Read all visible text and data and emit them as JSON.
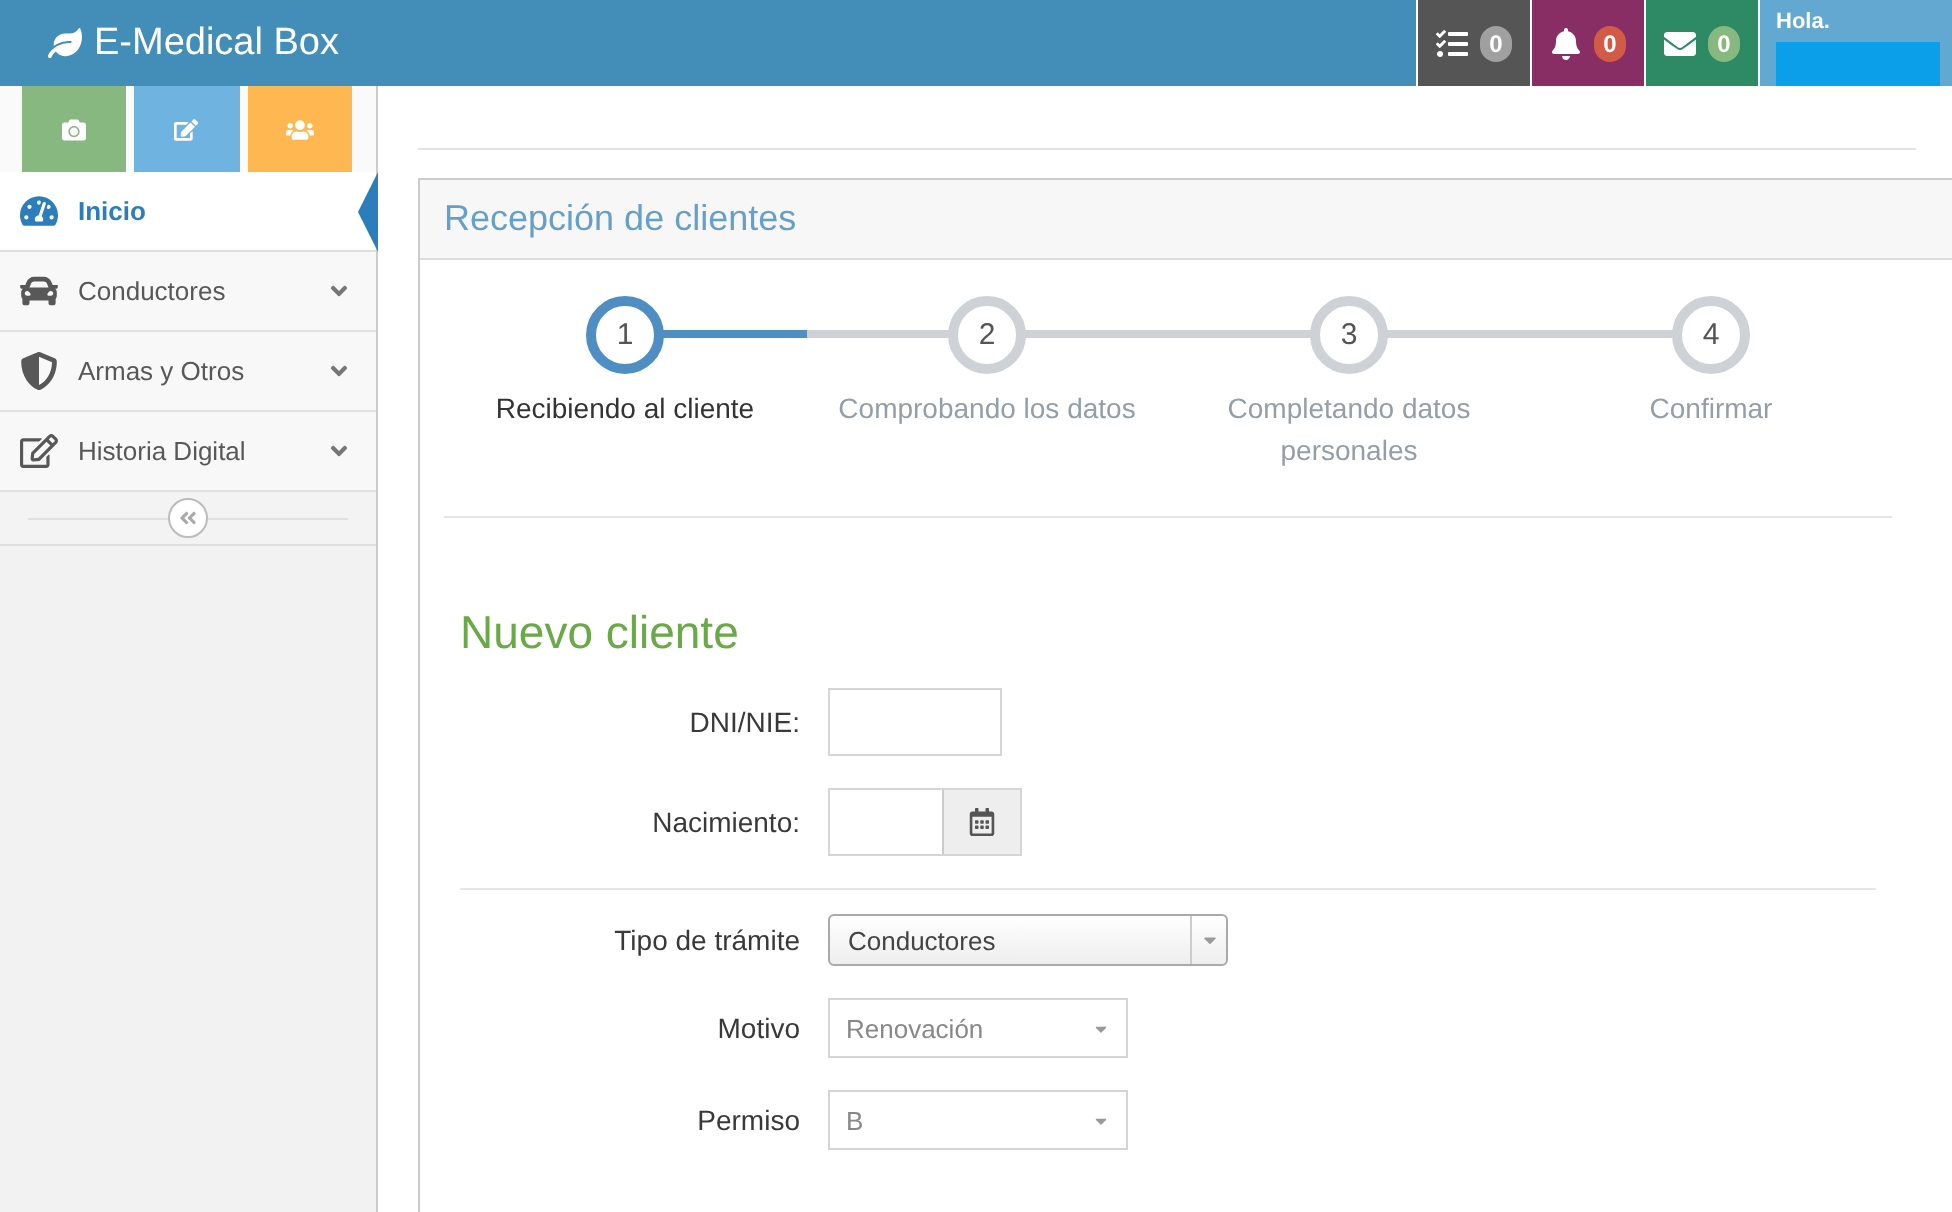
{
  "brand": {
    "title": "E-Medical Box"
  },
  "notifications": [
    {
      "count": "0",
      "color": "#555555"
    },
    {
      "count": "0",
      "color": "#892e65"
    },
    {
      "count": "0",
      "color": "#2e8965"
    }
  ],
  "user": {
    "greeting": "Hola."
  },
  "sidebar": {
    "items": [
      {
        "label": "Inicio",
        "selected": true,
        "expandable": false
      },
      {
        "label": "Conductores",
        "selected": false,
        "expandable": true
      },
      {
        "label": "Armas y Otros",
        "selected": false,
        "expandable": true
      },
      {
        "label": "Historia Digital",
        "selected": false,
        "expandable": true
      }
    ]
  },
  "panel": {
    "title": "Recepción de clientes"
  },
  "steps": [
    {
      "number": "1",
      "label": "Recibiendo al cliente",
      "selected": true
    },
    {
      "number": "2",
      "label": "Comprobando los datos",
      "selected": false
    },
    {
      "number": "3",
      "label": "Completando datos personales",
      "selected": false
    },
    {
      "number": "4",
      "label": "Confirmar",
      "selected": false
    }
  ],
  "form": {
    "title": "Nuevo cliente",
    "groups": [
      [
        {
          "kind": "text",
          "label": "DNI/NIE:"
        },
        {
          "kind": "date",
          "label": "Nacimiento:"
        }
      ],
      [
        {
          "kind": "chosen",
          "label": "Tipo de trámite",
          "value": "Conductores"
        },
        {
          "kind": "select",
          "label": "Motivo",
          "value": "Renovación",
          "disabled": true
        },
        {
          "kind": "select",
          "label": "Permiso",
          "value": "B",
          "disabled": true
        }
      ]
    ]
  }
}
